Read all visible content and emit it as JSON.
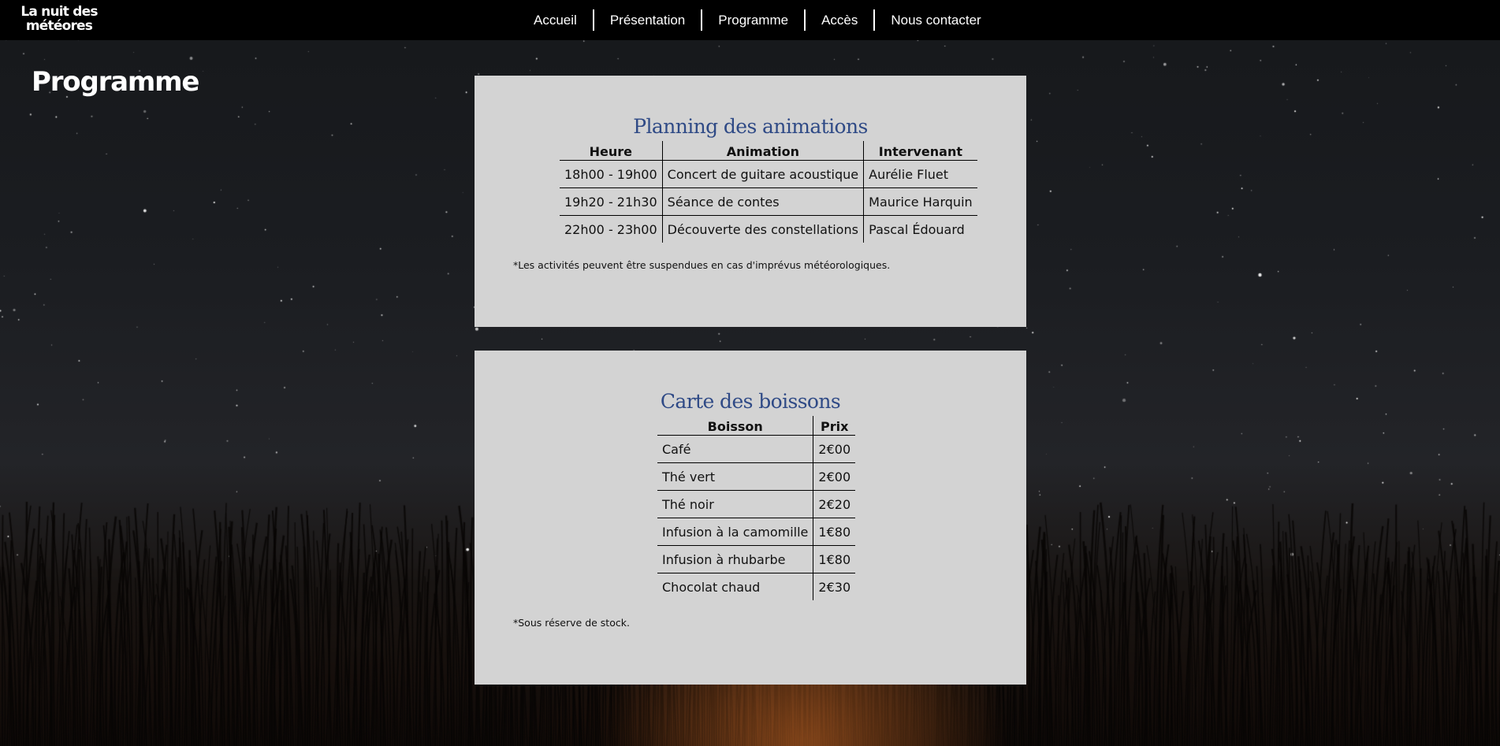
{
  "site": {
    "logo_line1": "La nuit des",
    "logo_line2": "météores"
  },
  "nav": {
    "items": [
      "Accueil",
      "Présentation",
      "Programme",
      "Accès",
      "Nous contacter"
    ]
  },
  "page": {
    "title": "Programme"
  },
  "planning": {
    "title": "Planning des animations",
    "headers": [
      "Heure",
      "Animation",
      "Intervenant"
    ],
    "rows": [
      [
        "18h00 - 19h00",
        "Concert de guitare acoustique",
        "Aurélie Fluet"
      ],
      [
        "19h20 - 21h30",
        "Séance de contes",
        "Maurice Harquin"
      ],
      [
        "22h00 - 23h00",
        "Découverte des constellations",
        "Pascal Édouard"
      ]
    ],
    "note": "*Les activités peuvent être suspendues en cas d'imprévus météorologiques."
  },
  "drinks": {
    "title": "Carte des boissons",
    "headers": [
      "Boisson",
      "Prix"
    ],
    "rows": [
      [
        "Café",
        "2€00"
      ],
      [
        "Thé vert",
        "2€00"
      ],
      [
        "Thé noir",
        "2€20"
      ],
      [
        "Infusion à la camomille",
        "1€80"
      ],
      [
        "Infusion à rhubarbe",
        "1€80"
      ],
      [
        "Chocolat chaud",
        "2€30"
      ]
    ],
    "note": "*Sous réserve de stock."
  },
  "colors": {
    "nav_background": "#000000",
    "card_background": "#d3d3d3",
    "heading_blue": "#2f4a86",
    "night_sky": "#1b1d21",
    "campfire_glow": "#be5f23"
  }
}
